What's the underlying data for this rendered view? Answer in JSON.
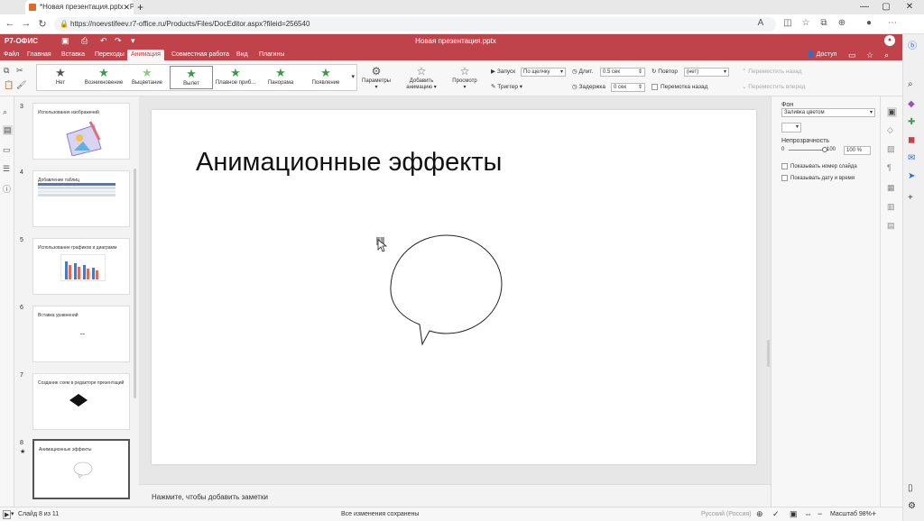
{
  "browser": {
    "tab_title": "*Новая презентация.pptx - Р7-О",
    "tab_close": "✕",
    "new_tab": "+",
    "url": "https://noevstifeev.r7-office.ru/Products/Files/DocEditor.aspx?fileid=256540",
    "win_min": "—",
    "win_max": "▢",
    "win_close": "✕"
  },
  "app": {
    "logo": "Р7-ОФИС",
    "doc_title": "Новая презентация.pptx",
    "access_label": "Доступ",
    "menu_tabs": [
      "Файл",
      "Главная",
      "Вставка",
      "Переходы",
      "Анимация",
      "Совместная работа",
      "Вид",
      "Плагины"
    ],
    "active_tab": "Анимация"
  },
  "ribbon": {
    "animations": [
      "Нет",
      "Возникновение",
      "Выцветание",
      "Вылет",
      "Плавное приб...",
      "Панорама",
      "Появление"
    ],
    "selected_animation": "Вылет",
    "params_label": "Параметры",
    "add_animation_label": "Добавить анимацию",
    "preview_label": "Просмотр",
    "start_label": "Запуск",
    "start_value": "По щелчку",
    "trigger_label": "Триггер",
    "duration_label": "Длит.",
    "duration_value": "0.5 сек",
    "delay_label": "Задержка",
    "delay_value": "0 сек",
    "repeat_label": "Повтор",
    "repeat_value": "(нет)",
    "rewind_label": "Перемотка назад",
    "move_back_label": "Переместить назад",
    "move_forward_label": "Переместить вперед"
  },
  "thumbnails": [
    {
      "num": "3",
      "title": "Использование изображений"
    },
    {
      "num": "4",
      "title": "Добавление таблиц"
    },
    {
      "num": "5",
      "title": "Использование графиков и диаграмм"
    },
    {
      "num": "6",
      "title": "Вставка уравнений"
    },
    {
      "num": "7",
      "title": "Создание схем в редакторе презентаций"
    },
    {
      "num": "8",
      "title": "Анимационные эффекты"
    }
  ],
  "slide": {
    "title": "Анимационные эффекты",
    "animation_marker": "1"
  },
  "notes_placeholder": "Нажмите, чтобы добавить заметки",
  "right_panel": {
    "background_label": "Фон",
    "fill_value": "Заливка цветом",
    "opacity_label": "Непрозрачность",
    "opacity_min": "0",
    "opacity_max": "100",
    "opacity_value": "100 %",
    "opacity_level": 1.0,
    "show_slide_number": "Показывать номер слайда",
    "show_date_time": "Показывать дату и время"
  },
  "status_bar": {
    "slide_info": "Слайд 8 из 11",
    "save_status": "Все изменения сохранены",
    "language": "Русский (Россия)",
    "zoom": "Масштаб 98%"
  },
  "colors": {
    "accent": "#c0424a",
    "star_green": "#3a9a4a"
  }
}
